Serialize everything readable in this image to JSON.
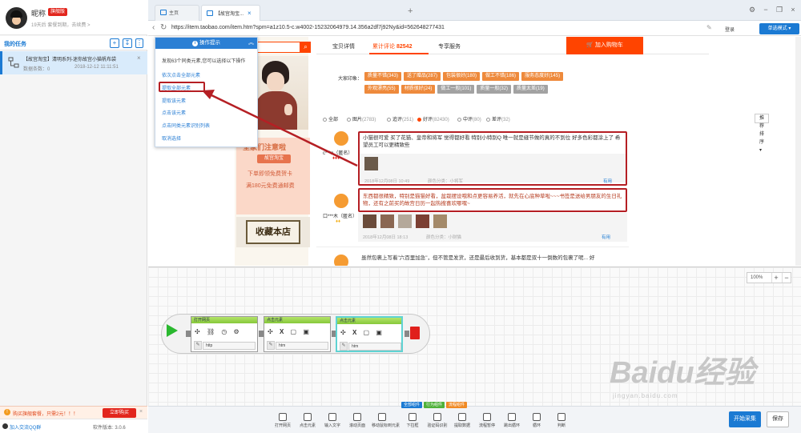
{
  "sidebar": {
    "nickname": "昵称",
    "vip_badge": "旗舰版",
    "vip_expire": "19天后 套餐到期，去续费 >",
    "task_header": "我的任务",
    "task": {
      "name": "【故宫淘宝】清明系列-迷你故宫小猫帆布袋",
      "sub": "数据条数：0",
      "time": "2018-12-12 11:11:51"
    },
    "promo_text": "购买旗舰套餐，只需2元！！！",
    "promo_button": "立即购买",
    "qq_group": "加入交流QQ群",
    "version": "软件版本: 3.0.6"
  },
  "browser": {
    "tabs": [
      {
        "label": "主页"
      },
      {
        "label": "【故宫淘宝..."
      }
    ],
    "url": "https://item.taobao.com/item.htm?spm=a1z10.5-c.w4002-15232064979.14.356a2df7j92Ny&id=562648277431",
    "login_link": "登录",
    "mode_select": "单选模式 ▾"
  },
  "product": {
    "tabs": [
      {
        "label": "宝贝详情"
      },
      {
        "label": "累计评论",
        "count": "82542"
      },
      {
        "label": "专享服务"
      }
    ],
    "cart_button": "加入购物车",
    "impression_label": "大家印象：",
    "tags_row1": [
      "质量不错(343)",
      "送了赠品(287)",
      "包装很好(180)",
      "做工不错(186)",
      "服务态度好(145)"
    ],
    "tags_row2": [
      "外观漂亮(55)",
      "材质很好(24)",
      "做工一般(101)",
      "质量一般(32)",
      "质量太差(19)"
    ],
    "filters": [
      {
        "label": "全部",
        "count": ""
      },
      {
        "label": "图片",
        "count": "(2783)"
      },
      {
        "label": "追评",
        "count": "(251)"
      },
      {
        "label": "好评",
        "count": "(82430)"
      },
      {
        "label": "中评",
        "count": "(80)"
      },
      {
        "label": "差评",
        "count": "(32)"
      }
    ],
    "sort_label": "推荐排序",
    "reviews": [
      {
        "name": "c***n（匿名）",
        "text": "小猫很可爱 买了花猫、皇帝和将军 觉得都好看 特别小特别Q 唯一就是缝节做的真的不到位 好多色彩都涂上了 希望员工可以更精致些",
        "date": "2018年12月08日 10:49",
        "spec": "颜色分类：小将军",
        "useful": "有用"
      },
      {
        "name": "口***木（匿名）",
        "text": "东西都很精致，特别是猫猫好看，盆栽摆设哦和点更容易养活，就先在心底种草啦~~~书签是送给男朋友的生日礼物，还有之前买的故宫日历一起热搜喜欢哪嘿~",
        "date": "2018年12月08日 18:13",
        "spec": "颜色分类：小财猫",
        "useful": "有用"
      },
      {
        "name": "",
        "text": "虽然包裹上写着\"六百里加急\"，但不管是发货，还是最后收到货，基本都是双十一倒数的包裹了呢... 好"
      }
    ],
    "coupon_title": "全家们注意啦",
    "coupon_tag": "故宫淘宝",
    "coupon_line2": "下单即领免费贺卡",
    "coupon_line3": "满180元免费通邮费",
    "sign_text": "收藏本店"
  },
  "popup": {
    "title": "操作提示",
    "description": "发现63个同类元素,您可以选择以下操作",
    "options": [
      "依次点击全部元素",
      "提取全部元素",
      "提取该元素",
      "点击该元素",
      "点击同类元素识别列表",
      "取消选择"
    ]
  },
  "designer": {
    "zoom": "100%",
    "blocks": [
      {
        "head": "打开网页",
        "foot": "http"
      },
      {
        "head": "点击元素",
        "foot": "htm"
      },
      {
        "head": "点击元素",
        "foot": "htm"
      }
    ],
    "watermark": "Baidu经验",
    "watermark_sub": "jingyan.baidu.com"
  },
  "toolbar": {
    "groups": [
      "全部组件",
      "行为组件",
      "流程组件"
    ],
    "tools": [
      "打开网页",
      "点击元素",
      "输入文字",
      "滚动页面",
      "移动鼠标到元素",
      "下拉框",
      "验证码识别",
      "提取数据",
      "流程暂停",
      "跳出循环",
      "循环",
      "判断"
    ],
    "start_collect": "开始采集",
    "save": "保存"
  },
  "colors": {
    "accent": "#1b7ad3",
    "taobao": "#ff4400",
    "highlight": "#b51f24"
  }
}
